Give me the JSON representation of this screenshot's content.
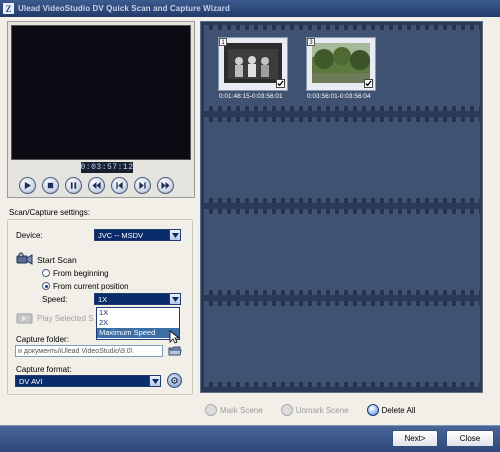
{
  "window": {
    "title": "Ulead VideoStudio DV Quick Scan and Capture Wizard"
  },
  "preview": {
    "timecode": "0:03:57:12",
    "controls": [
      "play",
      "stop",
      "pause",
      "rewind",
      "previous-frame",
      "next-frame",
      "fast-forward"
    ]
  },
  "scan": {
    "section_label": "Scan/Capture settings:",
    "device_label": "Device:",
    "device_value": "JVC -- MSDV",
    "start_scan_label": "Start Scan",
    "from_beginning_label": "From beginning",
    "from_current_label": "From current position",
    "speed_label": "Speed:",
    "speed_value": "1X",
    "speed_options": [
      "1X",
      "2X",
      "Maximum Speed"
    ],
    "play_selected_label": "Play Selected S",
    "capture_folder_label": "Capture folder:",
    "capture_folder_value": "и документы\\Ulead VideoStudio\\9.0\\",
    "capture_format_label": "Capture format:",
    "capture_format_value": "DV AVI"
  },
  "scenes": [
    {
      "number": "1",
      "time": "0:01:48:15-0:03:56:01",
      "checked": true
    },
    {
      "number": "3",
      "time": "0:03:56:01-0:03:56:04",
      "checked": true
    }
  ],
  "scene_actions": {
    "mark_scene": "Mark Scene",
    "unmark_scene": "Unmark Scene",
    "delete_all": "Delete All"
  },
  "footer": {
    "next": "Next>",
    "close": "Close"
  },
  "colors": {
    "film_bg": "#2a3a56",
    "accent": "#0a2c6b",
    "bottombar": "#2c4779"
  }
}
